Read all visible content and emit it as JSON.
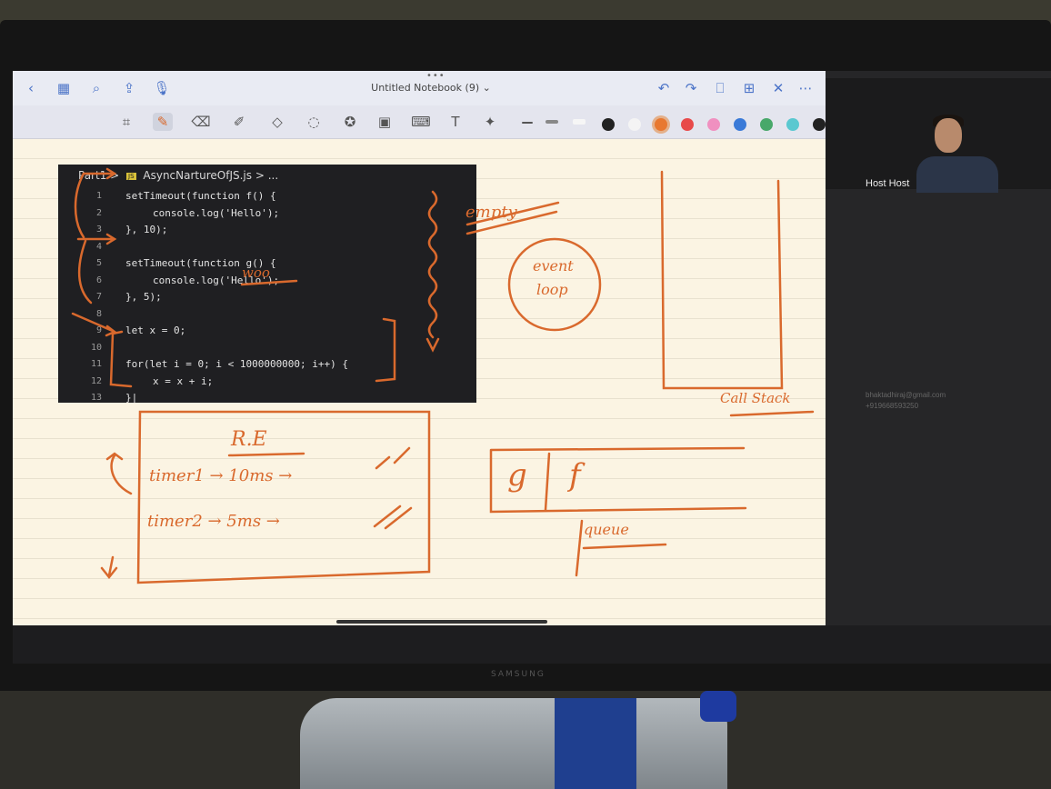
{
  "app": {
    "title": "Untitled Notebook (9)",
    "title_caret": "⌄",
    "more_dots": "•••"
  },
  "nav": {
    "left_icons": [
      "back-icon",
      "grid-icon",
      "search-icon",
      "share-icon",
      "microphone-icon"
    ],
    "right_icons": [
      "undo-icon",
      "redo-icon",
      "bookmark-icon",
      "add-page-icon",
      "close-icon",
      "more-icon"
    ]
  },
  "toolbar": {
    "tools": [
      "lasso-zoom-icon",
      "pen-icon",
      "eraser-icon",
      "highlighter-icon",
      "shapes-icon",
      "lasso-icon",
      "sticker-icon",
      "image-icon",
      "keyboard-icon",
      "text-icon",
      "laser-icon"
    ],
    "swatches": [
      "#222222",
      "#f4f4f4",
      "#e87830",
      "#e84a4a",
      "#f090c0",
      "#3a7ad8",
      "#48a86a",
      "#5ac8d0",
      "#222222"
    ]
  },
  "code": {
    "breadcrumb_part": "Part1",
    "breadcrumb_sep": ">",
    "js_badge": "JS",
    "file": "AsyncNartureOfJS.js",
    "breadcrumb_more": "> ...",
    "lines": [
      {
        "n": "1",
        "src": "setTimeout(function f() {"
      },
      {
        "n": "2",
        "src": "console.log('Hello');"
      },
      {
        "n": "3",
        "src": "}, 10);"
      },
      {
        "n": "4",
        "src": ""
      },
      {
        "n": "5",
        "src": "setTimeout(function g() {"
      },
      {
        "n": "6",
        "src": "console.log('Hello');"
      },
      {
        "n": "7",
        "src": "}, 5);"
      },
      {
        "n": "8",
        "src": ""
      },
      {
        "n": "9",
        "src": "let x = 0;"
      },
      {
        "n": "10",
        "src": ""
      },
      {
        "n": "11",
        "src": "for(let i = 0; i < 1000000000; i++) {"
      },
      {
        "n": "12",
        "src": "x = x + i;"
      },
      {
        "n": "13",
        "src": "}|"
      }
    ]
  },
  "handwriting": {
    "woo": "woo",
    "empty": "empty",
    "event": "event",
    "loop": "loop",
    "call_stack": "Call Stack",
    "re": "R.E",
    "timer1": "timer1 → 10ms →",
    "timer2": "timer2 → 5ms →",
    "q_g": "g",
    "q_f": "f",
    "queue": "queue"
  },
  "meeting": {
    "host_name": "Host Host",
    "host_email": "bhaktadhiraj@gmail.com",
    "host_phone": "+919668593250"
  },
  "device": {
    "brand": "SAMSUNG"
  },
  "colors": {
    "ink": "#d9692d",
    "accent": "#4c74c8"
  }
}
